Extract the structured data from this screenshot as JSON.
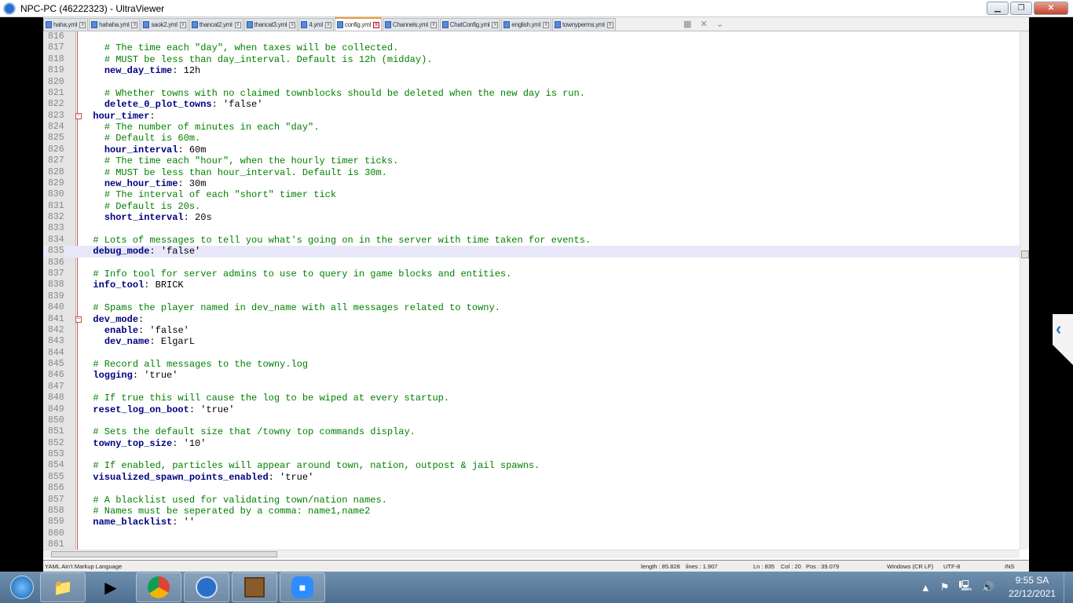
{
  "window": {
    "title": "NPC-PC (46222323) - UltraViewer",
    "buttons": [
      "minimize",
      "maximize",
      "close"
    ]
  },
  "tabs": [
    {
      "label": "haha.yml"
    },
    {
      "label": "hahaha.yml"
    },
    {
      "label": "saok2.yml"
    },
    {
      "label": "thancat2.yml"
    },
    {
      "label": "thancat3.yml"
    },
    {
      "label": "4.yml"
    },
    {
      "label": "config.yml",
      "active": true
    },
    {
      "label": "Channels.yml"
    },
    {
      "label": "ChatConfig.yml"
    },
    {
      "label": "english.yml"
    },
    {
      "label": "townyperms.yml"
    }
  ],
  "editor": {
    "current_line": 835,
    "lines": [
      {
        "n": "816",
        "i": 0
      },
      {
        "n": "817",
        "i": 2,
        "c": "# The time each \"day\", when taxes will be collected."
      },
      {
        "n": "818",
        "i": 2,
        "c": "# MUST be less than day_interval. Default is 12h (midday)."
      },
      {
        "n": "819",
        "i": 2,
        "k": "new_day_time",
        "v": " 12h"
      },
      {
        "n": "820",
        "i": 0
      },
      {
        "n": "821",
        "i": 2,
        "c": "# Whether towns with no claimed townblocks should be deleted when the new day is run."
      },
      {
        "n": "822",
        "i": 2,
        "k": "delete_0_plot_towns",
        "v": " 'false'"
      },
      {
        "n": "823",
        "i": 1,
        "k": "hour_timer",
        "v": "",
        "fold": true
      },
      {
        "n": "824",
        "i": 2,
        "c": "# The number of minutes in each \"day\"."
      },
      {
        "n": "825",
        "i": 2,
        "c": "# Default is 60m."
      },
      {
        "n": "826",
        "i": 2,
        "k": "hour_interval",
        "v": " 60m"
      },
      {
        "n": "827",
        "i": 2,
        "c": "# The time each \"hour\", when the hourly timer ticks."
      },
      {
        "n": "828",
        "i": 2,
        "c": "# MUST be less than hour_interval. Default is 30m."
      },
      {
        "n": "829",
        "i": 2,
        "k": "new_hour_time",
        "v": " 30m"
      },
      {
        "n": "830",
        "i": 2,
        "c": "# The interval of each \"short\" timer tick"
      },
      {
        "n": "831",
        "i": 2,
        "c": "# Default is 20s."
      },
      {
        "n": "832",
        "i": 2,
        "k": "short_interval",
        "v": " 20s"
      },
      {
        "n": "833",
        "i": 0
      },
      {
        "n": "834",
        "i": 1,
        "c": "# Lots of messages to tell you what's going on in the server with time taken for events."
      },
      {
        "n": "835",
        "i": 1,
        "k": "debug_mode",
        "v": " 'false'"
      },
      {
        "n": "836",
        "i": 0
      },
      {
        "n": "837",
        "i": 1,
        "c": "# Info tool for server admins to use to query in game blocks and entities."
      },
      {
        "n": "838",
        "i": 1,
        "k": "info_tool",
        "v": " BRICK"
      },
      {
        "n": "839",
        "i": 0
      },
      {
        "n": "840",
        "i": 1,
        "c": "# Spams the player named in dev_name with all messages related to towny."
      },
      {
        "n": "841",
        "i": 1,
        "k": "dev_mode",
        "v": "",
        "fold": true
      },
      {
        "n": "842",
        "i": 2,
        "k": "enable",
        "v": " 'false'"
      },
      {
        "n": "843",
        "i": 2,
        "k": "dev_name",
        "v": " ElgarL"
      },
      {
        "n": "844",
        "i": 0
      },
      {
        "n": "845",
        "i": 1,
        "c": "# Record all messages to the towny.log"
      },
      {
        "n": "846",
        "i": 1,
        "k": "logging",
        "v": " 'true'"
      },
      {
        "n": "847",
        "i": 0
      },
      {
        "n": "848",
        "i": 1,
        "c": "# If true this will cause the log to be wiped at every startup."
      },
      {
        "n": "849",
        "i": 1,
        "k": "reset_log_on_boot",
        "v": " 'true'"
      },
      {
        "n": "850",
        "i": 0
      },
      {
        "n": "851",
        "i": 1,
        "c": "# Sets the default size that /towny top commands display."
      },
      {
        "n": "852",
        "i": 1,
        "k": "towny_top_size",
        "v": " '10'"
      },
      {
        "n": "853",
        "i": 0
      },
      {
        "n": "854",
        "i": 1,
        "c": "# If enabled, particles will appear around town, nation, outpost & jail spawns."
      },
      {
        "n": "855",
        "i": 1,
        "k": "visualized_spawn_points_enabled",
        "v": " 'true'"
      },
      {
        "n": "856",
        "i": 0
      },
      {
        "n": "857",
        "i": 1,
        "c": "# A blacklist used for validating town/nation names."
      },
      {
        "n": "858",
        "i": 1,
        "c": "# Names must be seperated by a comma: name1,name2"
      },
      {
        "n": "859",
        "i": 1,
        "k": "name_blacklist",
        "v": " ''"
      },
      {
        "n": "860",
        "i": 0
      },
      {
        "n": "861",
        "i": 0
      }
    ]
  },
  "status": {
    "language": "YAML Ain't Markup Language",
    "length": "length : 85.828",
    "lines": "lines : 1.907",
    "ln": "Ln : 835",
    "col": "Col : 20",
    "pos": "Pos : 39.079",
    "eol": "Windows (CR LF)",
    "encoding": "UTF-8",
    "mode": "INS"
  },
  "taskbar": {
    "apps": [
      "file-explorer",
      "media-player",
      "chrome",
      "ultraviewer",
      "minecraft",
      "zoom"
    ],
    "clock_time": "9:55 SA",
    "clock_date": "22/12/2021"
  },
  "colors": {
    "keyword": "#00007f",
    "comment": "#008000",
    "current_line": "#e8e8fa",
    "tab_active_accent": "#f0a030"
  }
}
